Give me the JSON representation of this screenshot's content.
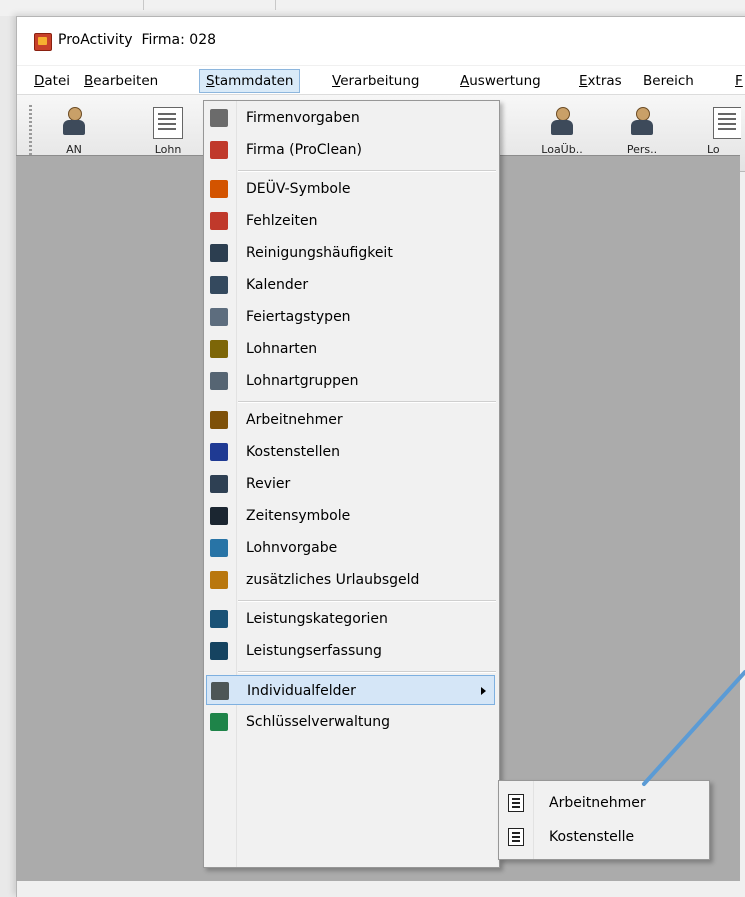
{
  "window": {
    "app_name": "ProActivity",
    "firm_label": "Firma: 028"
  },
  "menubar": [
    {
      "label": "Datei",
      "id": "datei",
      "active": false
    },
    {
      "label": "Bearbeiten",
      "id": "bearbeiten",
      "active": false
    },
    {
      "label": "Stammdaten",
      "id": "stammdaten",
      "active": true
    },
    {
      "label": "Verarbeitung",
      "id": "verarbeitung",
      "active": false
    },
    {
      "label": "Auswertung",
      "id": "auswertung",
      "active": false
    },
    {
      "label": "Extras",
      "id": "extras",
      "active": false
    },
    {
      "label": "Bereich",
      "id": "bereich",
      "active": false
    },
    {
      "label": "F",
      "id": "f",
      "active": false
    }
  ],
  "toolbar": [
    {
      "label": "AN",
      "icon": "employee-icon"
    },
    {
      "label": "Lohn",
      "icon": "wage-icon"
    },
    {
      "label": "LoaÜb..",
      "icon": "wage-transfer-icon"
    },
    {
      "label": "Pers..",
      "icon": "personnel-icon"
    },
    {
      "label": "Lo",
      "icon": "document-icon"
    }
  ],
  "stammdaten_menu": [
    {
      "label": "Firmenvorgaben",
      "icon": "company-defaults-icon"
    },
    {
      "label": "Firma (ProClean)",
      "icon": "company-icon"
    },
    {
      "sep": true
    },
    {
      "label": "DEÜV-Symbole",
      "icon": "deuev-symbols-icon"
    },
    {
      "label": "Fehlzeiten",
      "icon": "absence-icon"
    },
    {
      "label": "Reinigungshäufigkeit",
      "icon": "cleaning-frequency-icon"
    },
    {
      "label": "Kalender",
      "icon": "calendar-icon"
    },
    {
      "label": "Feiertagstypen",
      "icon": "holiday-types-icon"
    },
    {
      "label": "Lohnarten",
      "icon": "wage-types-icon"
    },
    {
      "label": "Lohnartgruppen",
      "icon": "wage-type-groups-icon"
    },
    {
      "sep": true
    },
    {
      "label": "Arbeitnehmer",
      "icon": "employee-icon"
    },
    {
      "label": "Kostenstellen",
      "icon": "cost-centers-icon"
    },
    {
      "label": "Revier",
      "icon": "district-icon"
    },
    {
      "label": "Zeitensymbole",
      "icon": "hourglass-icon"
    },
    {
      "label": "Lohnvorgabe",
      "icon": "wage-default-icon"
    },
    {
      "label": "zusätzliches Urlaubsgeld",
      "icon": "vacation-pay-icon"
    },
    {
      "sep": true
    },
    {
      "label": "Leistungskategorien",
      "icon": "service-categories-icon"
    },
    {
      "label": "Leistungserfassung",
      "icon": "service-recording-icon"
    },
    {
      "sep": true
    },
    {
      "label": "Individualfelder",
      "icon": "custom-fields-icon",
      "submenu": true,
      "highlight": true
    },
    {
      "label": "Schlüsselverwaltung",
      "icon": "key-management-icon"
    }
  ],
  "submenu": [
    {
      "label": "Arbeitnehmer",
      "icon": "list-icon"
    },
    {
      "label": "Kostenstelle",
      "icon": "list-icon"
    }
  ],
  "colors": {
    "highlight": "#d5e6f7",
    "annotation_arrow": "#5b9bd5",
    "client_area": "#ababab"
  }
}
